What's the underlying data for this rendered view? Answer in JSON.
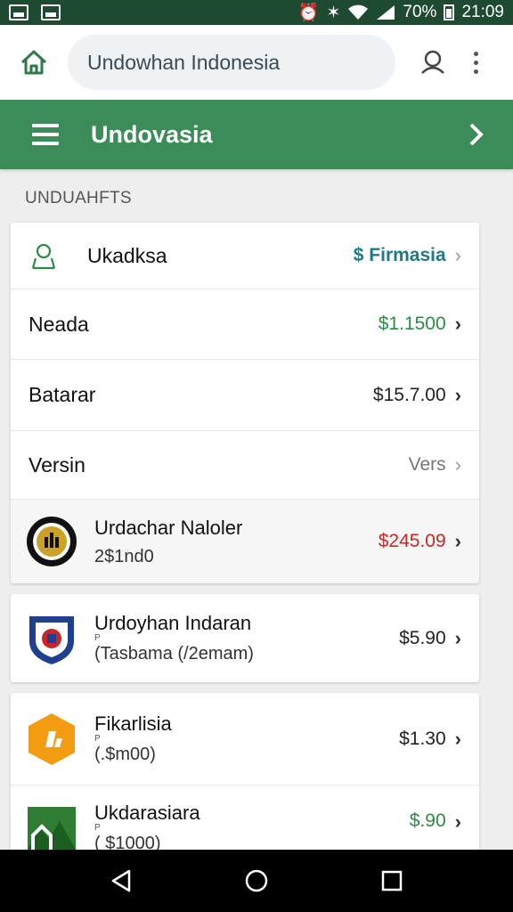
{
  "status": {
    "battery": "70%",
    "time": "21:09"
  },
  "top_bar": {
    "search_value": "Undowhan Indonesia"
  },
  "header": {
    "title": "Undovasia"
  },
  "section": {
    "label": "UNDUAHFTS"
  },
  "summary_card": {
    "header": {
      "label": "Ukadksa",
      "link": "$ Firmasia"
    },
    "rows": [
      {
        "label": "Neada",
        "value": "$1.1500"
      },
      {
        "label": "Batarar",
        "value": "$15.7.00"
      },
      {
        "label": "Versin",
        "value": "Vers"
      }
    ],
    "highlight": {
      "title": "Urdachar Naloler",
      "subtitle": "2$1nd0",
      "value": "$245.09"
    }
  },
  "items": [
    {
      "title": "Urdoyhan Indaran",
      "tiny": "P",
      "subtitle": "(Tasbama (/2emam)",
      "value": "$5.90"
    },
    {
      "title": "Fikarlisia",
      "tiny": "P",
      "subtitle": "(.$m00)",
      "value": "$1.30"
    },
    {
      "title": "Ukdarasiara",
      "tiny": "P",
      "subtitle": "( $1000)",
      "value": "$.90"
    }
  ],
  "colors": {
    "status_bar": "#1e4a32",
    "header": "#3c8c5a",
    "price_green": "#2e8b45",
    "price_red": "#c62828",
    "link_teal": "#1d7a86"
  }
}
